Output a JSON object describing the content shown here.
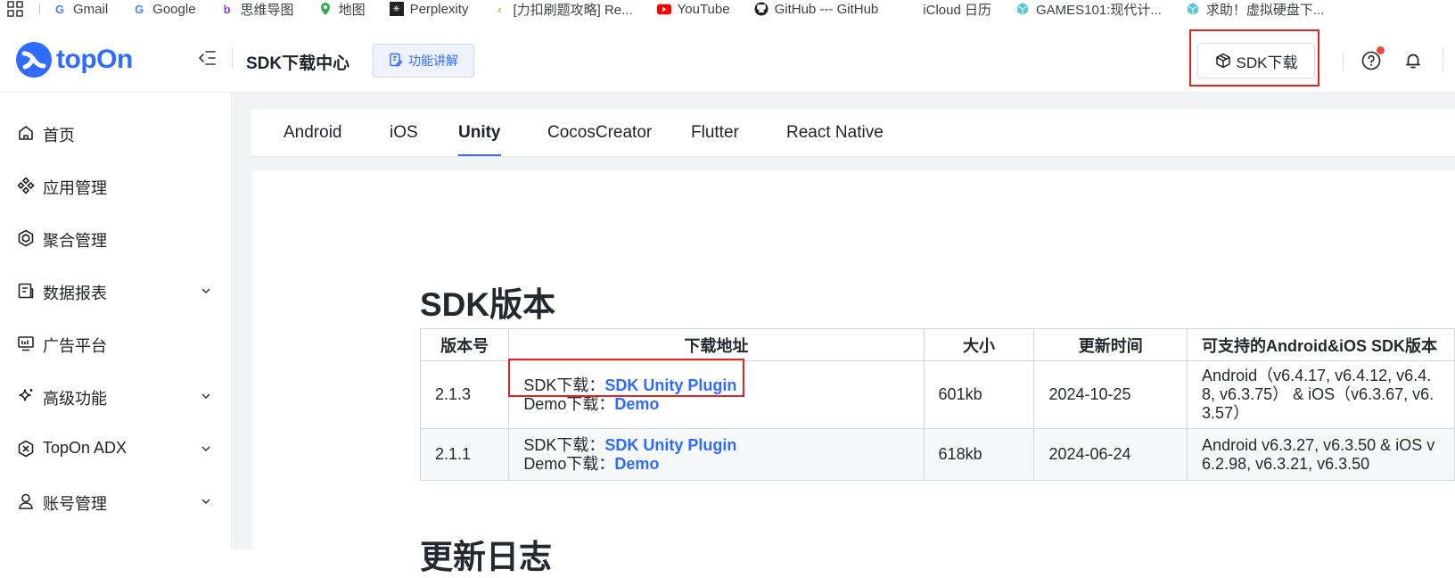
{
  "bookmarks": [
    {
      "label": "Gmail",
      "icon": "google-g-icon"
    },
    {
      "label": "Google",
      "icon": "google-g-icon"
    },
    {
      "label": "思维导图",
      "icon": "boardmix-icon"
    },
    {
      "label": "地图",
      "icon": "map-pin-icon"
    },
    {
      "label": "Perplexity",
      "icon": "perplexity-icon"
    },
    {
      "label": "[力扣刷题攻略] Re...",
      "icon": "leetcode-icon"
    },
    {
      "label": "YouTube",
      "icon": "youtube-icon"
    },
    {
      "label": "GitHub --- GitHub",
      "icon": "github-icon"
    },
    {
      "label": "iCloud 日历",
      "icon": "apple-icon"
    },
    {
      "label": "GAMES101:现代计...",
      "icon": "cube-icon"
    },
    {
      "label": "求助！虚拟硬盘下...",
      "icon": "cube-icon"
    }
  ],
  "header": {
    "logo_text": "topOn",
    "page_title": "SDK下载中心",
    "explain_button": "功能讲解",
    "sdk_download_button": "SDK下载"
  },
  "sidebar": {
    "items": [
      {
        "label": "首页",
        "icon": "home-icon",
        "expandable": false
      },
      {
        "label": "应用管理",
        "icon": "apps-icon",
        "expandable": false
      },
      {
        "label": "聚合管理",
        "icon": "hexagon-icon",
        "expandable": false
      },
      {
        "label": "数据报表",
        "icon": "report-icon",
        "expandable": true
      },
      {
        "label": "广告平台",
        "icon": "monitor-icon",
        "expandable": false
      },
      {
        "label": "高级功能",
        "icon": "sparkle-icon",
        "expandable": true
      },
      {
        "label": "TopOn ADX",
        "icon": "adx-icon",
        "expandable": true
      },
      {
        "label": "账号管理",
        "icon": "user-icon",
        "expandable": true
      }
    ]
  },
  "tabs": {
    "items": [
      "Android",
      "iOS",
      "Unity",
      "CocosCreator",
      "Flutter",
      "React Native"
    ],
    "active": "Unity"
  },
  "sdk_section": {
    "title": "SDK版本",
    "columns": [
      "版本号",
      "下载地址",
      "大小",
      "更新时间",
      "可支持的Android&iOS SDK版本"
    ],
    "rows": [
      {
        "version": "2.1.3",
        "sdk_label": "SDK下载：",
        "sdk_link": "SDK Unity Plugin",
        "demo_label": "Demo下载：",
        "demo_link": "Demo",
        "size": "601kb",
        "date": "2024-10-25",
        "support": [
          "Android（v6.4.17, v6.4.12, v6.4.",
          "8, v6.3.75） & iOS（v6.3.67, v6.",
          "3.57）"
        ]
      },
      {
        "version": "2.1.1",
        "sdk_label": "SDK下载：",
        "sdk_link": "SDK Unity Plugin",
        "demo_label": "Demo下载：",
        "demo_link": "Demo",
        "size": "618kb",
        "date": "2024-06-24",
        "support": [
          "Android v6.3.27, v6.3.50 & iOS v",
          "6.2.98, v6.3.21, v6.3.50"
        ]
      }
    ]
  },
  "changelog_title": "更新日志",
  "colors": {
    "accent": "#2f6bff",
    "highlight_box": "#e02424",
    "notification_dot": "#f04848"
  }
}
